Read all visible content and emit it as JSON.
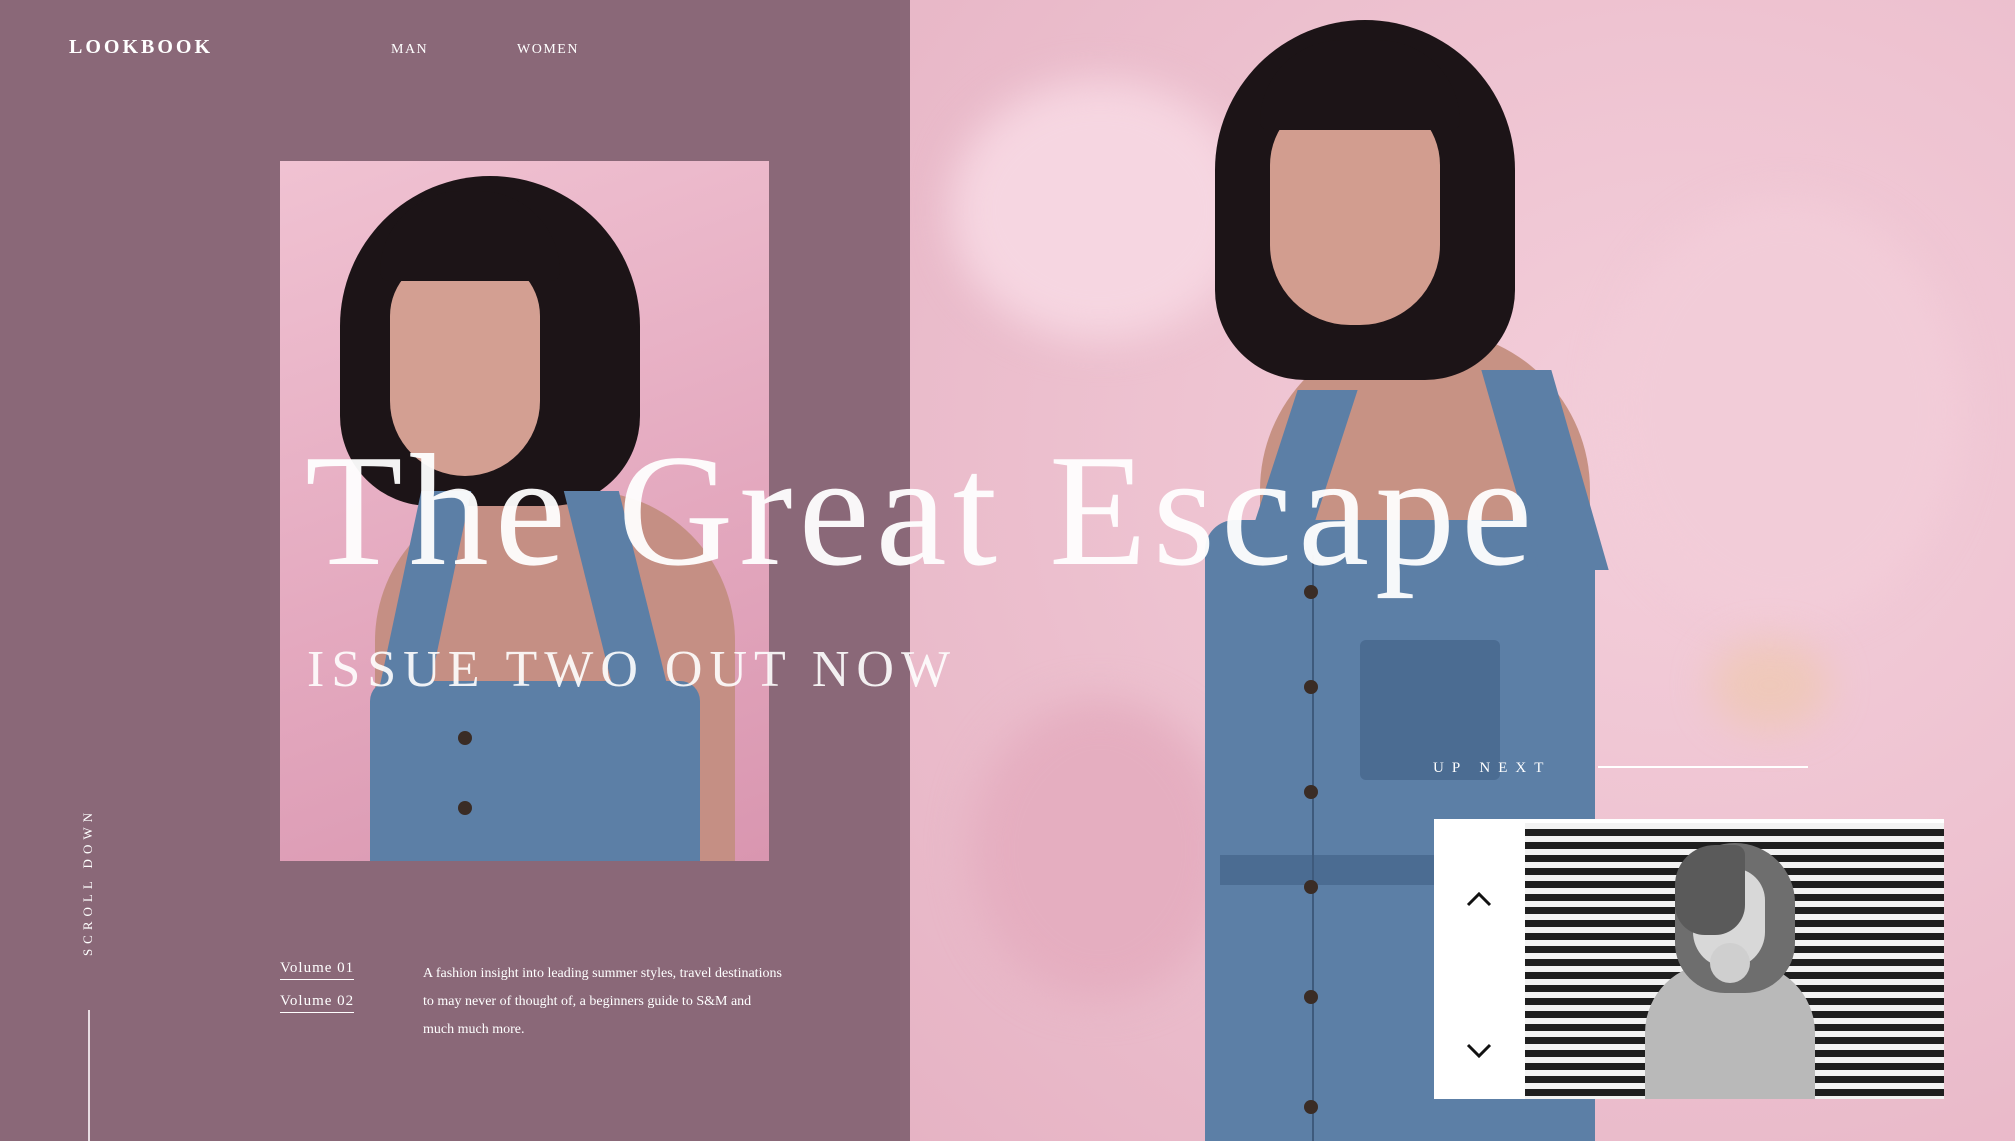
{
  "header": {
    "logo": "LOOKBOOK",
    "nav": [
      {
        "label": "MAN"
      },
      {
        "label": "WOMEN"
      }
    ]
  },
  "hero": {
    "headline": "The Great Escape",
    "subhead": "ISSUE TWO OUT NOW"
  },
  "sidebar": {
    "scroll_label": "SCROLL DOWN"
  },
  "volumes": [
    {
      "label": "Volume 01"
    },
    {
      "label": "Volume 02"
    }
  ],
  "description": "A fashion insight into leading summer styles, travel destinations to may never of thought of, a beginners guide to S&M and much much more.",
  "up_next": {
    "label": "UP NEXT",
    "controls": {
      "up_icon": "chevron-up-icon",
      "down_icon": "chevron-down-icon"
    }
  },
  "colors": {
    "panel": "#8a6878",
    "hero_pink": "#f0c6d4",
    "denim": "#5c7fa6",
    "text": "#ffffff"
  }
}
